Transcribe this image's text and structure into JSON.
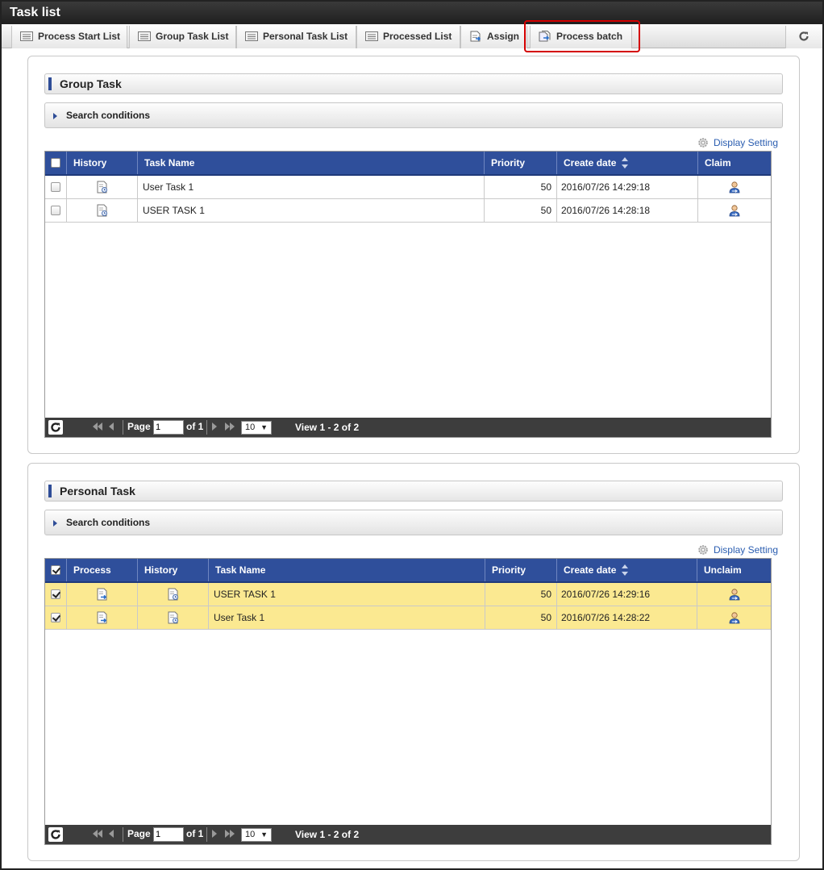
{
  "window": {
    "title": "Task list"
  },
  "tabs": [
    {
      "label": "Process Start List",
      "icon": "list-icon"
    },
    {
      "label": "Group Task List",
      "icon": "list-icon"
    },
    {
      "label": "Personal Task List",
      "icon": "list-icon"
    },
    {
      "label": "Processed List",
      "icon": "list-icon"
    },
    {
      "label": "Assign",
      "icon": "assign-icon"
    },
    {
      "label": "Process batch",
      "icon": "process-batch-icon",
      "highlighted": true
    }
  ],
  "group_task": {
    "title": "Group Task",
    "search_label": "Search conditions",
    "display_setting": "Display Setting",
    "columns": {
      "history": "History",
      "task_name": "Task Name",
      "priority": "Priority",
      "create_date": "Create date",
      "claim": "Claim"
    },
    "rows": [
      {
        "task_name": "User Task 1",
        "priority": "50",
        "create_date": "2016/07/26 14:29:18",
        "checked": false
      },
      {
        "task_name": "USER TASK 1",
        "priority": "50",
        "create_date": "2016/07/26 14:28:18",
        "checked": false
      }
    ],
    "pager": {
      "page_label": "Page",
      "page_value": "1",
      "of_label": "of 1",
      "rows_per_page": "10",
      "view_text": "View 1 - 2 of 2"
    }
  },
  "personal_task": {
    "title": "Personal Task",
    "search_label": "Search conditions",
    "display_setting": "Display Setting",
    "columns": {
      "process": "Process",
      "history": "History",
      "task_name": "Task Name",
      "priority": "Priority",
      "create_date": "Create date",
      "unclaim": "Unclaim"
    },
    "rows": [
      {
        "task_name": "USER TASK 1",
        "priority": "50",
        "create_date": "2016/07/26 14:29:16",
        "checked": true
      },
      {
        "task_name": "User Task 1",
        "priority": "50",
        "create_date": "2016/07/26 14:28:22",
        "checked": true
      }
    ],
    "pager": {
      "page_label": "Page",
      "page_value": "1",
      "of_label": "of 1",
      "rows_per_page": "10",
      "view_text": "View 1 - 2 of 2"
    }
  },
  "colors": {
    "header_blue": "#2f4f9b",
    "selected_row": "#fbe991",
    "highlight_red": "#d40000",
    "link_blue": "#2a5db0"
  }
}
